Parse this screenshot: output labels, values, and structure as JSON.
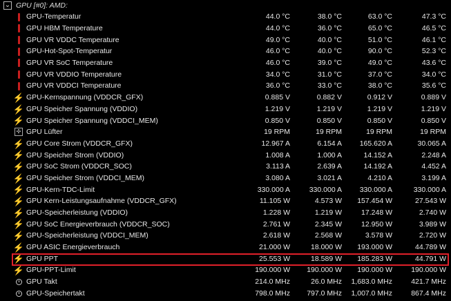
{
  "group_title": "GPU [#0]: AMD:",
  "rows": [
    {
      "icon": "thermometer-icon",
      "label": "GPU-Temperatur",
      "v": [
        "44.0 °C",
        "38.0 °C",
        "63.0 °C",
        "47.3 °C"
      ]
    },
    {
      "icon": "thermometer-icon",
      "label": "GPU HBM Temperature",
      "v": [
        "44.0 °C",
        "36.0 °C",
        "65.0 °C",
        "46.5 °C"
      ]
    },
    {
      "icon": "thermometer-icon",
      "label": "GPU VR VDDC Temperature",
      "v": [
        "49.0 °C",
        "40.0 °C",
        "51.0 °C",
        "46.1 °C"
      ]
    },
    {
      "icon": "thermometer-icon",
      "label": "GPU-Hot-Spot-Temperatur",
      "v": [
        "46.0 °C",
        "40.0 °C",
        "90.0 °C",
        "52.3 °C"
      ]
    },
    {
      "icon": "thermometer-icon",
      "label": "GPU VR SoC Temperature",
      "v": [
        "46.0 °C",
        "39.0 °C",
        "49.0 °C",
        "43.6 °C"
      ]
    },
    {
      "icon": "thermometer-icon",
      "label": "GPU VR VDDIO Temperature",
      "v": [
        "34.0 °C",
        "31.0 °C",
        "37.0 °C",
        "34.0 °C"
      ]
    },
    {
      "icon": "thermometer-icon",
      "label": "GPU VR VDDCI Temperature",
      "v": [
        "36.0 °C",
        "33.0 °C",
        "38.0 °C",
        "35.6 °C"
      ]
    },
    {
      "icon": "lightning-icon",
      "label": "GPU-Kernspannung (VDDCR_GFX)",
      "v": [
        "0.885 V",
        "0.882 V",
        "0.912 V",
        "0.889 V"
      ]
    },
    {
      "icon": "lightning-icon",
      "label": "GPU Speicher Spannung (VDDIO)",
      "v": [
        "1.219 V",
        "1.219 V",
        "1.219 V",
        "1.219 V"
      ]
    },
    {
      "icon": "lightning-icon",
      "label": "GPU Speicher Spannung (VDDCI_MEM)",
      "v": [
        "0.850 V",
        "0.850 V",
        "0.850 V",
        "0.850 V"
      ]
    },
    {
      "icon": "fan-icon",
      "label": "GPU Lüfter",
      "v": [
        "19 RPM",
        "19 RPM",
        "19 RPM",
        "19 RPM"
      ]
    },
    {
      "icon": "lightning-icon",
      "label": "GPU Core Strom (VDDCR_GFX)",
      "v": [
        "12.967 A",
        "6.154 A",
        "165.620 A",
        "30.065 A"
      ]
    },
    {
      "icon": "lightning-icon",
      "label": "GPU Speicher Strom (VDDIO)",
      "v": [
        "1.008 A",
        "1.000 A",
        "14.152 A",
        "2.248 A"
      ]
    },
    {
      "icon": "lightning-icon",
      "label": "GPU SoC Strom (VDDCR_SOC)",
      "v": [
        "3.113 A",
        "2.639 A",
        "14.192 A",
        "4.452 A"
      ]
    },
    {
      "icon": "lightning-icon",
      "label": "GPU Speicher Strom (VDDCI_MEM)",
      "v": [
        "3.080 A",
        "3.021 A",
        "4.210 A",
        "3.199 A"
      ]
    },
    {
      "icon": "lightning-icon",
      "label": "GPU-Kern-TDC-Limit",
      "v": [
        "330.000 A",
        "330.000 A",
        "330.000 A",
        "330.000 A"
      ]
    },
    {
      "icon": "lightning-icon",
      "label": "GPU Kern-Leistungsaufnahme (VDDCR_GFX)",
      "v": [
        "11.105 W",
        "4.573 W",
        "157.454 W",
        "27.543 W"
      ]
    },
    {
      "icon": "lightning-icon",
      "label": "GPU-Speicherleistung (VDDIO)",
      "v": [
        "1.228 W",
        "1.219 W",
        "17.248 W",
        "2.740 W"
      ]
    },
    {
      "icon": "lightning-icon",
      "label": "GPU SoC Energieverbrauch (VDDCR_SOC)",
      "v": [
        "2.761 W",
        "2.345 W",
        "12.950 W",
        "3.989 W"
      ]
    },
    {
      "icon": "lightning-icon",
      "label": "GPU-Speicherleistung (VDDCI_MEM)",
      "v": [
        "2.618 W",
        "2.568 W",
        "3.578 W",
        "2.720 W"
      ]
    },
    {
      "icon": "lightning-icon",
      "label": "GPU ASIC Energieverbrauch",
      "v": [
        "21.000 W",
        "18.000 W",
        "193.000 W",
        "44.789 W"
      ]
    },
    {
      "icon": "lightning-icon",
      "label": "GPU PPT",
      "v": [
        "25.553 W",
        "18.589 W",
        "185.283 W",
        "44.791 W"
      ]
    },
    {
      "icon": "lightning-icon",
      "label": "GPU-PPT-Limit",
      "v": [
        "190.000 W",
        "190.000 W",
        "190.000 W",
        "190.000 W"
      ]
    },
    {
      "icon": "clock-icon",
      "label": "GPU Takt",
      "v": [
        "214.0 MHz",
        "26.0 MHz",
        "1,683.0 MHz",
        "421.7 MHz"
      ]
    },
    {
      "icon": "clock-icon",
      "label": "GPU-Speichertakt",
      "v": [
        "798.0 MHz",
        "797.0 MHz",
        "1,007.0 MHz",
        "867.4 MHz"
      ]
    }
  ],
  "colors": {
    "highlight": "#e0202a",
    "thermometer": "#c81e1e",
    "lightning": "#f0b400",
    "background": "#000000",
    "text": "#e8e8e8"
  }
}
